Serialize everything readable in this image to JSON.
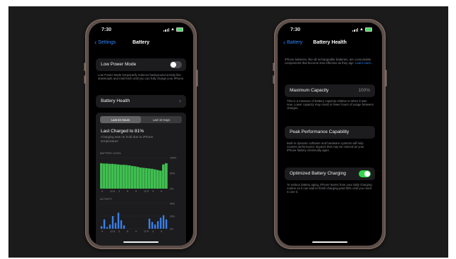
{
  "left_phone": {
    "status_time": "7:30",
    "nav": {
      "back_label": "Settings",
      "title": "Battery"
    },
    "low_power": {
      "label": "Low Power Mode",
      "enabled": false,
      "footer": "Low Power Mode temporarily reduces background activity like downloads and mail fetch until you can fully charge your iPhone."
    },
    "battery_health_label": "Battery Health",
    "tabs": [
      "Last 24 Hours",
      "Last 10 Days"
    ],
    "active_tab": "Last 24 Hours",
    "charge_title": "Last Charged to 81%",
    "charge_subtitle": "Charging was on hold due to iPhone temperature",
    "level_chart_title": "BATTERY LEVEL",
    "level_y_ticks": [
      "100%",
      "50%",
      "0%"
    ],
    "level_x_ticks": [
      "9",
      "12 A",
      "3",
      "6",
      "9",
      "12 P",
      "3",
      "6"
    ],
    "activity_chart_title": "ACTIVITY",
    "activity_y_ticks": [
      "60m",
      "30m",
      "0m"
    ],
    "activity_x_ticks": [
      "9",
      "12 A",
      "3",
      "6",
      "9",
      "12 P",
      "3",
      "6"
    ],
    "colors": {
      "level_fill": "#3fbf4f",
      "activity_bar": "#3a7fe8",
      "accent": "#2f86ff"
    }
  },
  "right_phone": {
    "status_time": "7:30",
    "nav": {
      "back_label": "Battery",
      "title": "Battery Health"
    },
    "intro": "iPhone batteries, like all rechargeable batteries, are consumable components that become less effective as they age.",
    "intro_link": "Learn more...",
    "max_capacity": {
      "label": "Maximum Capacity",
      "value": "100%"
    },
    "max_capacity_note": "This is a measure of battery capacity relative to when it was new. Lower capacity may result in fewer hours of usage between charges.",
    "peak_performance": {
      "label": "Peak Performance Capability"
    },
    "peak_note": "Built-in dynamic software and hardware systems will help counter performance impacts that may be noticed as your iPhone battery chemically ages.",
    "optimized_charging": {
      "label": "Optimized Battery Charging",
      "enabled": true
    },
    "optimized_note": "To reduce battery aging, iPhone learns from your daily charging routine so it can wait to finish charging past 80% until you need to use it."
  },
  "chart_data": [
    {
      "type": "area",
      "title": "BATTERY LEVEL",
      "x": [
        "9",
        "12 A",
        "3",
        "6",
        "9",
        "12 P",
        "3",
        "6"
      ],
      "ylim": [
        0,
        100
      ],
      "yticks": [
        "0%",
        "50%",
        "100%"
      ],
      "values": [
        82,
        81,
        81,
        80,
        80,
        79,
        78,
        77,
        77,
        76,
        75,
        73,
        72,
        70,
        68,
        67,
        66,
        65,
        64,
        62,
        60,
        58,
        78,
        82
      ]
    },
    {
      "type": "bar",
      "title": "ACTIVITY",
      "x": [
        "9",
        "12 A",
        "3",
        "6",
        "9",
        "12 P",
        "3",
        "6"
      ],
      "ylim": [
        0,
        60
      ],
      "yticks": [
        "0m",
        "30m",
        "60m"
      ],
      "values": [
        6,
        22,
        4,
        10,
        30,
        14,
        38,
        20,
        8,
        0,
        0,
        0,
        0,
        0,
        0,
        0,
        0,
        24,
        16,
        10,
        18,
        26,
        32,
        22
      ]
    }
  ]
}
